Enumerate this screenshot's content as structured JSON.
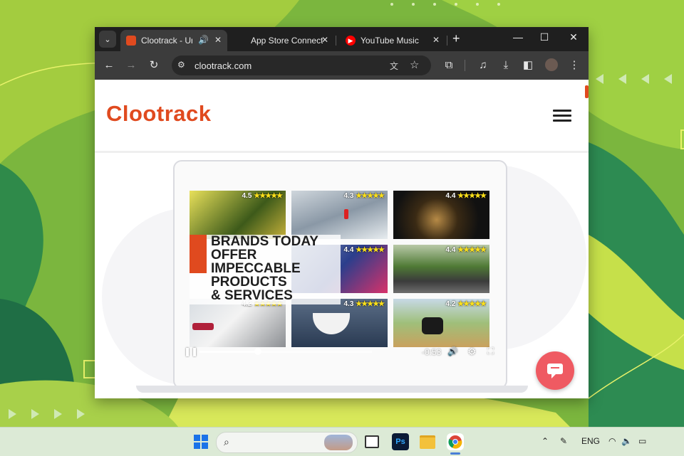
{
  "browser": {
    "tabs": [
      {
        "title": "Clootrack - Unc",
        "favicon_color": "#e04a1f",
        "active": true,
        "audio": true
      },
      {
        "title": "App Store Connect",
        "favicon": "apple-icon",
        "active": false
      },
      {
        "title": "YouTube Music",
        "favicon_color": "#ff0000",
        "active": false
      }
    ],
    "url": "clootrack.com"
  },
  "page": {
    "logo": "Clootrack",
    "accent_color": "#e04a1f",
    "video": {
      "headline_lines": [
        "BRANDS TODAY",
        "OFFER",
        "IMPECCABLE",
        "PRODUCTS",
        "& SERVICES"
      ],
      "tiles": [
        {
          "rating": "4.5",
          "stars": "★★★★★"
        },
        {
          "rating": "4.3",
          "stars": "★★★★★"
        },
        {
          "rating": "4.4",
          "stars": "★★★★★"
        },
        {
          "rating": "4.4",
          "stars": "★★★★★"
        },
        {
          "rating": "4.4",
          "stars": "★★★★★"
        },
        {
          "rating": "4.2",
          "stars": "★★★★★"
        },
        {
          "rating": "4.3",
          "stars": "★★★★★"
        },
        {
          "rating": "4.2",
          "stars": "★★★★★"
        }
      ],
      "time_remaining": "-0:53",
      "progress": 0.34
    },
    "chat_button_color": "#ef5a62"
  },
  "taskbar": {
    "apps": [
      "windows-start-icon",
      "search",
      "task-view-icon",
      "photoshop-icon",
      "file-explorer-icon",
      "chrome-icon"
    ],
    "ps_label": "Ps",
    "language": "ENG"
  }
}
